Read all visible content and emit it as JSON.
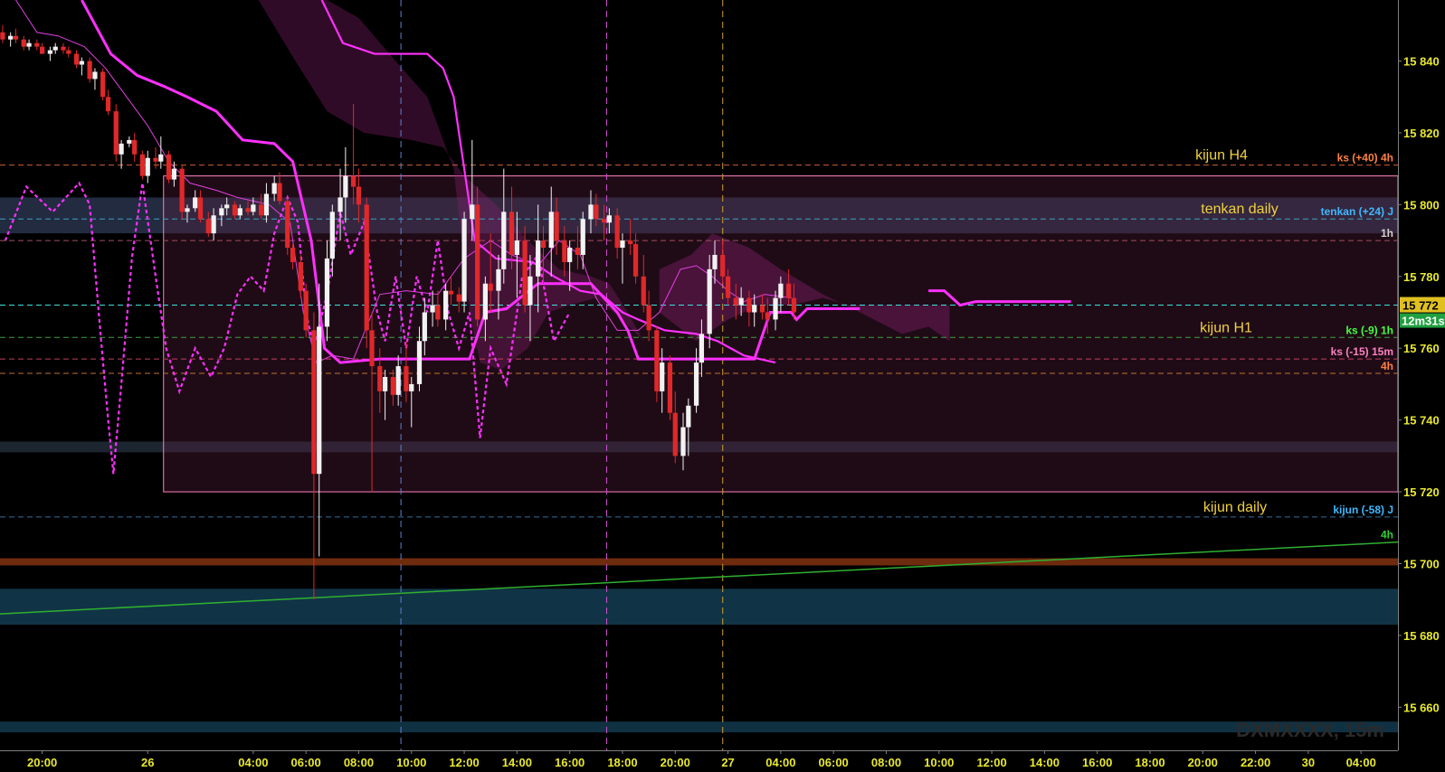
{
  "chart_data": {
    "type": "candlestick",
    "symbol_label": "DXMXXXX, 15m",
    "y_ticks": [
      {
        "v": 15840,
        "label": "15 840"
      },
      {
        "v": 15820,
        "label": "15 820"
      },
      {
        "v": 15800,
        "label": "15 800"
      },
      {
        "v": 15780,
        "label": "15 780"
      },
      {
        "v": 15760,
        "label": "15 760"
      },
      {
        "v": 15740,
        "label": "15 740"
      },
      {
        "v": 15720,
        "label": "15 720"
      },
      {
        "v": 15700,
        "label": "15 700"
      },
      {
        "v": 15680,
        "label": "15 680"
      },
      {
        "v": 15660,
        "label": "15 660"
      }
    ],
    "ylim": [
      15648,
      15857
    ],
    "x_ticks": [
      {
        "t": 20,
        "label": "20:00"
      },
      {
        "t": 24,
        "label": "26"
      },
      {
        "t": 28,
        "label": "04:00"
      },
      {
        "t": 30,
        "label": "06:00"
      },
      {
        "t": 32,
        "label": "08:00"
      },
      {
        "t": 34,
        "label": "10:00"
      },
      {
        "t": 36,
        "label": "12:00"
      },
      {
        "t": 38,
        "label": "14:00"
      },
      {
        "t": 40,
        "label": "16:00"
      },
      {
        "t": 42,
        "label": "18:00"
      },
      {
        "t": 44,
        "label": "20:00"
      },
      {
        "t": 46,
        "label": "27"
      },
      {
        "t": 48,
        "label": "04:00"
      },
      {
        "t": 50,
        "label": "06:00"
      },
      {
        "t": 52,
        "label": "08:00"
      },
      {
        "t": 54,
        "label": "10:00"
      },
      {
        "t": 56,
        "label": "12:00"
      },
      {
        "t": 58,
        "label": "14:00"
      },
      {
        "t": 60,
        "label": "16:00"
      },
      {
        "t": 62,
        "label": "18:00"
      },
      {
        "t": 64,
        "label": "20:00"
      },
      {
        "t": 66,
        "label": "22:00"
      },
      {
        "t": 68,
        "label": "30"
      },
      {
        "t": 70,
        "label": "04:00"
      }
    ],
    "xlim": [
      18.4,
      71.4
    ],
    "levels": [
      {
        "name": "kijun H4",
        "value": 15811,
        "color": "#d06030",
        "tag": "ks (+40) 4h",
        "tag_color": "#ff8040"
      },
      {
        "name": "tenkan daily",
        "value": 15796,
        "color": "#40a0c0",
        "tag": "tenkan (+24) J",
        "tag_color": "#40b8ff"
      },
      {
        "name": "",
        "value": 15790,
        "color": "#a05060",
        "tag": "1h",
        "tag_color": "#d0d0d0"
      },
      {
        "name": "",
        "value": 15772,
        "color": "#40e0e0",
        "tag": "",
        "tag_color": "#40e0e0"
      },
      {
        "name": "kijun H1",
        "value": 15763,
        "color": "#40a040",
        "tag": "ks (-9) 1h",
        "tag_color": "#40ff40"
      },
      {
        "name": "",
        "value": 15757,
        "color": "#c04060",
        "tag": "ks (-15) 15m",
        "tag_color": "#ff80c0"
      },
      {
        "name": "",
        "value": 15753,
        "color": "#c07030",
        "tag": "4h",
        "tag_color": "#ff8040"
      },
      {
        "name": "kijun daily",
        "value": 15713,
        "color": "#3070a0",
        "tag": "kijun (-58) J",
        "tag_color": "#40b8ff"
      }
    ],
    "price_boxes": [
      {
        "label": "15 772",
        "bg": "#e0c020",
        "fg": "#000"
      },
      {
        "label": "12m31s",
        "bg": "#20a040",
        "fg": "#fff"
      }
    ],
    "sma_tag": "4h",
    "candles": [
      [
        18.5,
        15848,
        15850,
        15845,
        15846
      ],
      [
        18.8,
        15846,
        15848,
        15844,
        15847
      ],
      [
        19.0,
        15847,
        15849,
        15845,
        15846
      ],
      [
        19.3,
        15846,
        15847,
        15843,
        15844
      ],
      [
        19.5,
        15844,
        15846,
        15843,
        15845
      ],
      [
        19.8,
        15845,
        15846,
        15843,
        15844
      ],
      [
        20.0,
        15844,
        15845,
        15842,
        15842
      ],
      [
        20.3,
        15842,
        15844,
        15840,
        15843
      ],
      [
        20.5,
        15843,
        15845,
        15842,
        15844
      ],
      [
        20.8,
        15844,
        15845,
        15842,
        15843
      ],
      [
        21.0,
        15843,
        15844,
        15841,
        15842
      ],
      [
        21.3,
        15842,
        15843,
        15838,
        15839
      ],
      [
        21.5,
        15839,
        15841,
        15836,
        15840
      ],
      [
        21.8,
        15840,
        15841,
        15834,
        15835
      ],
      [
        22.0,
        15835,
        15838,
        15832,
        15837
      ],
      [
        22.3,
        15837,
        15838,
        15829,
        15830
      ],
      [
        22.5,
        15830,
        15832,
        15825,
        15826
      ],
      [
        22.8,
        15826,
        15828,
        15812,
        15814
      ],
      [
        23.0,
        15814,
        15818,
        15810,
        15817
      ],
      [
        23.3,
        15817,
        15819,
        15816,
        15818
      ],
      [
        23.5,
        15818,
        15820,
        15812,
        15814
      ],
      [
        23.8,
        15814,
        15815,
        15807,
        15808
      ],
      [
        24.0,
        15808,
        15815,
        15806,
        15813
      ],
      [
        24.3,
        15813,
        15816,
        15810,
        15812
      ],
      [
        24.5,
        15812,
        15819,
        15810,
        15814
      ],
      [
        24.8,
        15814,
        15815,
        15806,
        15807
      ],
      [
        25.0,
        15807,
        15812,
        15805,
        15810
      ],
      [
        25.3,
        15810,
        15811,
        15796,
        15798
      ],
      [
        25.5,
        15798,
        15800,
        15795,
        15799
      ],
      [
        25.8,
        15799,
        15804,
        15798,
        15802
      ],
      [
        26.0,
        15802,
        15804,
        15795,
        15796
      ],
      [
        26.3,
        15796,
        15798,
        15791,
        15792
      ],
      [
        26.5,
        15792,
        15799,
        15790,
        15797
      ],
      [
        26.8,
        15797,
        15800,
        15794,
        15799
      ],
      [
        27.0,
        15799,
        15802,
        15797,
        15800
      ],
      [
        27.3,
        15800,
        15801,
        15796,
        15797
      ],
      [
        27.5,
        15797,
        15800,
        15796,
        15799
      ],
      [
        27.8,
        15799,
        15801,
        15797,
        15798
      ],
      [
        28.0,
        15798,
        15802,
        15797,
        15800
      ],
      [
        28.3,
        15800,
        15803,
        15796,
        15797
      ],
      [
        28.5,
        15797,
        15806,
        15795,
        15803
      ],
      [
        28.8,
        15803,
        15808,
        15801,
        15806
      ],
      [
        29.0,
        15806,
        15809,
        15800,
        15801
      ],
      [
        29.3,
        15801,
        15802,
        15786,
        15788
      ],
      [
        29.5,
        15788,
        15789,
        15782,
        15784
      ],
      [
        29.8,
        15784,
        15786,
        15774,
        15776
      ],
      [
        30.0,
        15776,
        15778,
        15763,
        15765
      ],
      [
        30.3,
        15765,
        15770,
        15690,
        15725
      ],
      [
        30.5,
        15725,
        15778,
        15702,
        15766
      ],
      [
        30.8,
        15766,
        15790,
        15762,
        15785
      ],
      [
        31.0,
        15785,
        15800,
        15780,
        15798
      ],
      [
        31.3,
        15798,
        15810,
        15790,
        15802
      ],
      [
        31.5,
        15802,
        15816,
        15795,
        15808
      ],
      [
        31.8,
        15808,
        15828,
        15800,
        15805
      ],
      [
        32.0,
        15805,
        15810,
        15795,
        15800
      ],
      [
        32.3,
        15800,
        15802,
        15760,
        15765
      ],
      [
        32.5,
        15765,
        15770,
        15720,
        15755
      ],
      [
        32.8,
        15755,
        15760,
        15742,
        15748
      ],
      [
        33.0,
        15748,
        15754,
        15740,
        15752
      ],
      [
        33.3,
        15752,
        15754,
        15744,
        15747
      ],
      [
        33.5,
        15747,
        15758,
        15744,
        15755
      ],
      [
        33.8,
        15755,
        15762,
        15745,
        15748
      ],
      [
        34.0,
        15748,
        15752,
        15738,
        15750
      ],
      [
        34.3,
        15750,
        15766,
        15748,
        15762
      ],
      [
        34.5,
        15762,
        15774,
        15758,
        15770
      ],
      [
        34.8,
        15770,
        15776,
        15766,
        15772
      ],
      [
        35.0,
        15772,
        15776,
        15766,
        15768
      ],
      [
        35.3,
        15768,
        15778,
        15765,
        15776
      ],
      [
        35.5,
        15776,
        15780,
        15772,
        15775
      ],
      [
        35.8,
        15775,
        15777,
        15770,
        15773
      ],
      [
        36.0,
        15773,
        15798,
        15770,
        15796
      ],
      [
        36.3,
        15796,
        15818,
        15790,
        15800
      ],
      [
        36.5,
        15800,
        15805,
        15766,
        15768
      ],
      [
        36.8,
        15768,
        15780,
        15762,
        15778
      ],
      [
        37.0,
        15778,
        15792,
        15770,
        15776
      ],
      [
        37.3,
        15776,
        15786,
        15768,
        15782
      ],
      [
        37.5,
        15782,
        15810,
        15778,
        15798
      ],
      [
        37.8,
        15798,
        15805,
        15782,
        15786
      ],
      [
        38.0,
        15786,
        15798,
        15774,
        15790
      ],
      [
        38.3,
        15790,
        15794,
        15770,
        15772
      ],
      [
        38.5,
        15772,
        15786,
        15762,
        15780
      ],
      [
        38.8,
        15780,
        15800,
        15770,
        15790
      ],
      [
        39.0,
        15790,
        15794,
        15778,
        15788
      ],
      [
        39.3,
        15788,
        15805,
        15780,
        15798
      ],
      [
        39.5,
        15798,
        15802,
        15786,
        15790
      ],
      [
        39.8,
        15790,
        15794,
        15780,
        15784
      ],
      [
        40.0,
        15784,
        15790,
        15776,
        15788
      ],
      [
        40.3,
        15788,
        15794,
        15782,
        15786
      ],
      [
        40.5,
        15786,
        15798,
        15782,
        15796
      ],
      [
        40.8,
        15796,
        15804,
        15792,
        15800
      ],
      [
        41.0,
        15800,
        15803,
        15794,
        15796
      ],
      [
        41.3,
        15796,
        15800,
        15790,
        15795
      ],
      [
        41.5,
        15795,
        15799,
        15792,
        15797
      ],
      [
        41.8,
        15797,
        15799,
        15785,
        15788
      ],
      [
        42.0,
        15788,
        15792,
        15778,
        15790
      ],
      [
        42.3,
        15790,
        15796,
        15786,
        15789
      ],
      [
        42.5,
        15789,
        15792,
        15778,
        15780
      ],
      [
        42.8,
        15780,
        15786,
        15770,
        15772
      ],
      [
        43.0,
        15772,
        15776,
        15762,
        15765
      ],
      [
        43.3,
        15765,
        15766,
        15745,
        15748
      ],
      [
        43.5,
        15748,
        15760,
        15742,
        15756
      ],
      [
        43.8,
        15756,
        15758,
        15740,
        15742
      ],
      [
        44.0,
        15742,
        15748,
        15728,
        15730
      ],
      [
        44.3,
        15730,
        15742,
        15726,
        15738
      ],
      [
        44.5,
        15738,
        15746,
        15730,
        15744
      ],
      [
        44.8,
        15744,
        15760,
        15742,
        15756
      ],
      [
        45.0,
        15756,
        15768,
        15752,
        15764
      ],
      [
        45.3,
        15764,
        15786,
        15760,
        15782
      ],
      [
        45.5,
        15782,
        15790,
        15778,
        15786
      ],
      [
        45.8,
        15786,
        15790,
        15778,
        15780
      ],
      [
        46.0,
        15780,
        15782,
        15772,
        15774
      ],
      [
        46.3,
        15774,
        15778,
        15768,
        15772
      ],
      [
        46.5,
        15772,
        15777,
        15769,
        15774
      ],
      [
        46.8,
        15774,
        15776,
        15766,
        15770
      ],
      [
        47.0,
        15770,
        15775,
        15766,
        15772
      ],
      [
        47.3,
        15772,
        15775,
        15768,
        15770
      ],
      [
        47.5,
        15770,
        15774,
        15764,
        15768
      ],
      [
        47.8,
        15768,
        15776,
        15765,
        15774
      ],
      [
        48.0,
        15774,
        15780,
        15770,
        15778
      ],
      [
        48.3,
        15778,
        15782,
        15772,
        15774
      ],
      [
        48.5,
        15774,
        15778,
        15768,
        15770
      ]
    ]
  }
}
